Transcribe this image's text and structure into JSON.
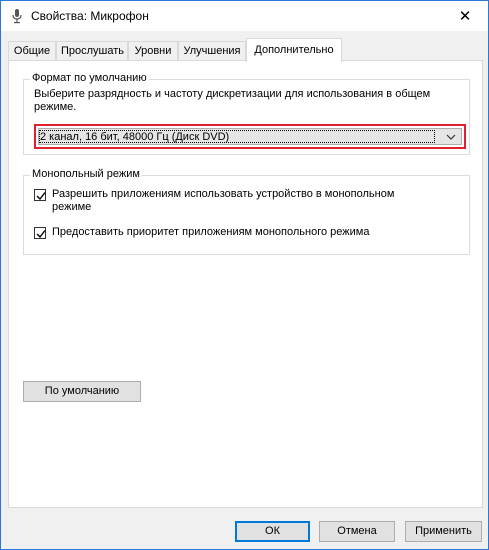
{
  "window": {
    "title": "Свойства: Микрофон",
    "close_glyph": "✕"
  },
  "tabs": [
    {
      "label": "Общие"
    },
    {
      "label": "Прослушать"
    },
    {
      "label": "Уровни"
    },
    {
      "label": "Улучшения"
    },
    {
      "label": "Дополнительно"
    }
  ],
  "default_format": {
    "legend": "Формат по умолчанию",
    "description": "Выберите разрядность и частоту дискретизации для использования в общем режиме.",
    "selected_value": "2 канал, 16 бит, 48000 Гц (Диск DVD)",
    "highlight_color": "#e0202e"
  },
  "exclusive_mode": {
    "legend": "Монопольный режим",
    "options": [
      {
        "label": "Разрешить приложениям использовать устройство в монопольном режиме",
        "checked": true
      },
      {
        "label": "Предоставить приоритет приложениям монопольного режима",
        "checked": true
      }
    ]
  },
  "buttons": {
    "restore_defaults": "По умолчанию",
    "ok": "ОК",
    "cancel": "Отмена",
    "apply": "Применить"
  },
  "icons": {
    "title": "microphone-icon",
    "close": "close-icon",
    "combo": "chevron-down-icon",
    "check": "checkmark-icon"
  }
}
